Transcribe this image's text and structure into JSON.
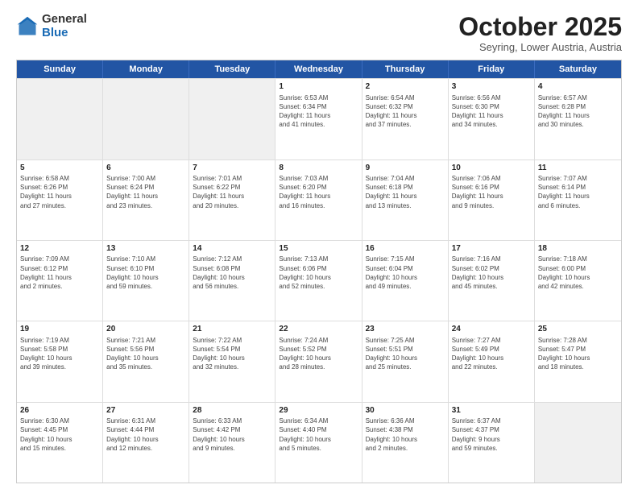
{
  "logo": {
    "general": "General",
    "blue": "Blue"
  },
  "header": {
    "month": "October 2025",
    "location": "Seyring, Lower Austria, Austria"
  },
  "days": [
    "Sunday",
    "Monday",
    "Tuesday",
    "Wednesday",
    "Thursday",
    "Friday",
    "Saturday"
  ],
  "rows": [
    [
      {
        "day": "",
        "content": "",
        "shaded": true
      },
      {
        "day": "",
        "content": "",
        "shaded": true
      },
      {
        "day": "",
        "content": "",
        "shaded": true
      },
      {
        "day": "1",
        "content": "Sunrise: 6:53 AM\nSunset: 6:34 PM\nDaylight: 11 hours\nand 41 minutes."
      },
      {
        "day": "2",
        "content": "Sunrise: 6:54 AM\nSunset: 6:32 PM\nDaylight: 11 hours\nand 37 minutes."
      },
      {
        "day": "3",
        "content": "Sunrise: 6:56 AM\nSunset: 6:30 PM\nDaylight: 11 hours\nand 34 minutes."
      },
      {
        "day": "4",
        "content": "Sunrise: 6:57 AM\nSunset: 6:28 PM\nDaylight: 11 hours\nand 30 minutes."
      }
    ],
    [
      {
        "day": "5",
        "content": "Sunrise: 6:58 AM\nSunset: 6:26 PM\nDaylight: 11 hours\nand 27 minutes."
      },
      {
        "day": "6",
        "content": "Sunrise: 7:00 AM\nSunset: 6:24 PM\nDaylight: 11 hours\nand 23 minutes."
      },
      {
        "day": "7",
        "content": "Sunrise: 7:01 AM\nSunset: 6:22 PM\nDaylight: 11 hours\nand 20 minutes."
      },
      {
        "day": "8",
        "content": "Sunrise: 7:03 AM\nSunset: 6:20 PM\nDaylight: 11 hours\nand 16 minutes."
      },
      {
        "day": "9",
        "content": "Sunrise: 7:04 AM\nSunset: 6:18 PM\nDaylight: 11 hours\nand 13 minutes."
      },
      {
        "day": "10",
        "content": "Sunrise: 7:06 AM\nSunset: 6:16 PM\nDaylight: 11 hours\nand 9 minutes."
      },
      {
        "day": "11",
        "content": "Sunrise: 7:07 AM\nSunset: 6:14 PM\nDaylight: 11 hours\nand 6 minutes."
      }
    ],
    [
      {
        "day": "12",
        "content": "Sunrise: 7:09 AM\nSunset: 6:12 PM\nDaylight: 11 hours\nand 2 minutes."
      },
      {
        "day": "13",
        "content": "Sunrise: 7:10 AM\nSunset: 6:10 PM\nDaylight: 10 hours\nand 59 minutes."
      },
      {
        "day": "14",
        "content": "Sunrise: 7:12 AM\nSunset: 6:08 PM\nDaylight: 10 hours\nand 56 minutes."
      },
      {
        "day": "15",
        "content": "Sunrise: 7:13 AM\nSunset: 6:06 PM\nDaylight: 10 hours\nand 52 minutes."
      },
      {
        "day": "16",
        "content": "Sunrise: 7:15 AM\nSunset: 6:04 PM\nDaylight: 10 hours\nand 49 minutes."
      },
      {
        "day": "17",
        "content": "Sunrise: 7:16 AM\nSunset: 6:02 PM\nDaylight: 10 hours\nand 45 minutes."
      },
      {
        "day": "18",
        "content": "Sunrise: 7:18 AM\nSunset: 6:00 PM\nDaylight: 10 hours\nand 42 minutes."
      }
    ],
    [
      {
        "day": "19",
        "content": "Sunrise: 7:19 AM\nSunset: 5:58 PM\nDaylight: 10 hours\nand 39 minutes."
      },
      {
        "day": "20",
        "content": "Sunrise: 7:21 AM\nSunset: 5:56 PM\nDaylight: 10 hours\nand 35 minutes."
      },
      {
        "day": "21",
        "content": "Sunrise: 7:22 AM\nSunset: 5:54 PM\nDaylight: 10 hours\nand 32 minutes."
      },
      {
        "day": "22",
        "content": "Sunrise: 7:24 AM\nSunset: 5:52 PM\nDaylight: 10 hours\nand 28 minutes."
      },
      {
        "day": "23",
        "content": "Sunrise: 7:25 AM\nSunset: 5:51 PM\nDaylight: 10 hours\nand 25 minutes."
      },
      {
        "day": "24",
        "content": "Sunrise: 7:27 AM\nSunset: 5:49 PM\nDaylight: 10 hours\nand 22 minutes."
      },
      {
        "day": "25",
        "content": "Sunrise: 7:28 AM\nSunset: 5:47 PM\nDaylight: 10 hours\nand 18 minutes."
      }
    ],
    [
      {
        "day": "26",
        "content": "Sunrise: 6:30 AM\nSunset: 4:45 PM\nDaylight: 10 hours\nand 15 minutes."
      },
      {
        "day": "27",
        "content": "Sunrise: 6:31 AM\nSunset: 4:44 PM\nDaylight: 10 hours\nand 12 minutes."
      },
      {
        "day": "28",
        "content": "Sunrise: 6:33 AM\nSunset: 4:42 PM\nDaylight: 10 hours\nand 9 minutes."
      },
      {
        "day": "29",
        "content": "Sunrise: 6:34 AM\nSunset: 4:40 PM\nDaylight: 10 hours\nand 5 minutes."
      },
      {
        "day": "30",
        "content": "Sunrise: 6:36 AM\nSunset: 4:38 PM\nDaylight: 10 hours\nand 2 minutes."
      },
      {
        "day": "31",
        "content": "Sunrise: 6:37 AM\nSunset: 4:37 PM\nDaylight: 9 hours\nand 59 minutes."
      },
      {
        "day": "",
        "content": "",
        "shaded": true
      }
    ]
  ]
}
